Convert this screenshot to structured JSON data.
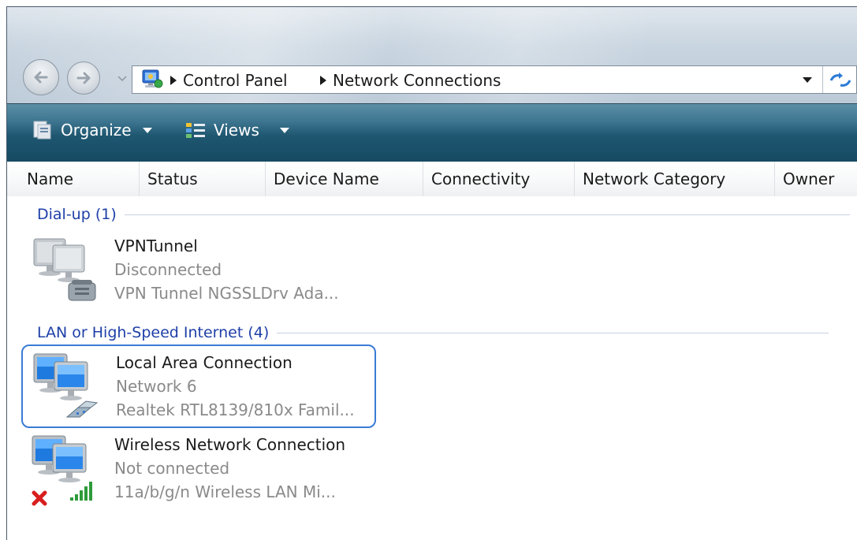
{
  "address_bar": {
    "icon": "control-panel-icon",
    "breadcrumbs": [
      "Control Panel",
      "Network Connections"
    ]
  },
  "toolbar": {
    "organize_label": "Organize",
    "views_label": "Views"
  },
  "columns": [
    "Name",
    "Status",
    "Device Name",
    "Connectivity",
    "Network Category",
    "Owner"
  ],
  "groups": [
    {
      "title": "Dial-up (1)",
      "items": [
        {
          "name": "VPNTunnel",
          "status": "Disconnected",
          "device": "VPN Tunnel NGSSLDrv Ada...",
          "icon": "dialup-connection-icon"
        }
      ]
    },
    {
      "title": "LAN or High-Speed Internet (4)",
      "items": [
        {
          "name": "Local Area Connection",
          "status": "Network  6",
          "device": "Realtek RTL8139/810x Famil...",
          "icon": "lan-connection-icon",
          "selected": true
        },
        {
          "name": "Wireless Network Connection",
          "status": "Not connected",
          "device": "11a/b/g/n Wireless LAN Mi...",
          "icon": "wireless-connection-icon"
        }
      ]
    }
  ],
  "colors": {
    "toolbar": "#1e5670",
    "group_header": "#1e3fa8",
    "selection_border": "#3a7cd6"
  }
}
